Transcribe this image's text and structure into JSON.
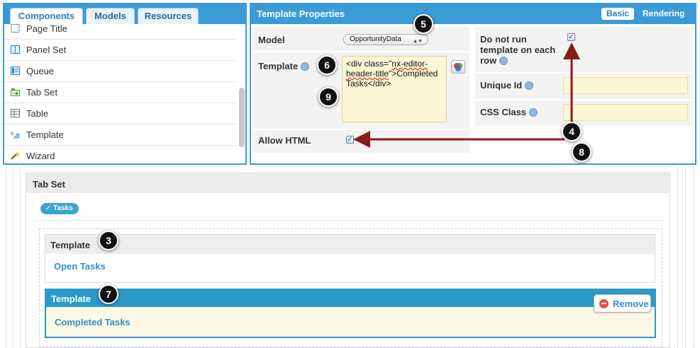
{
  "left_panel": {
    "tabs": [
      {
        "label": "Components",
        "active": true
      },
      {
        "label": "Models",
        "active": false
      },
      {
        "label": "Resources",
        "active": false
      }
    ],
    "items": [
      {
        "label": "Page Title",
        "icon": "page-icon"
      },
      {
        "label": "Panel Set",
        "icon": "panel-set-icon"
      },
      {
        "label": "Queue",
        "icon": "queue-icon"
      },
      {
        "label": "Tab Set",
        "icon": "tab-set-icon"
      },
      {
        "label": "Table",
        "icon": "table-icon"
      },
      {
        "label": "Template",
        "icon": "template-icon"
      },
      {
        "label": "Wizard",
        "icon": "wizard-wand-icon"
      }
    ]
  },
  "properties": {
    "title": "Template Properties",
    "tabs": [
      {
        "label": "Basic",
        "active": true
      },
      {
        "label": "Rendering",
        "active": false
      }
    ],
    "model_label": "Model",
    "model_value": "OpportunityData",
    "template_label": "Template",
    "template_value_parts": [
      "<div class=\"",
      "nx-editor-header-title",
      "\">Completed Tasks</div>"
    ],
    "allow_html_label": "Allow HTML",
    "allow_html_checked": true,
    "do_not_run_label": "Do not run template on each row",
    "do_not_run_checked": true,
    "unique_id_label": "Unique Id",
    "unique_id_value": "",
    "css_class_label": "CSS Class",
    "css_class_value": ""
  },
  "canvas": {
    "tabset_title": "Tab Set",
    "tab_pill": "Tasks",
    "templates": [
      {
        "title": "Template",
        "link": "Open Tasks",
        "selected": false
      },
      {
        "title": "Template",
        "link": "Completed Tasks",
        "selected": true
      }
    ],
    "remove_label": "Remove"
  },
  "callouts": [
    "3",
    "4",
    "5",
    "6",
    "7",
    "8",
    "9"
  ],
  "colors": {
    "accent": "#3a9bd6",
    "link": "#2f8fc6",
    "input_yellow": "#fbf6d4",
    "arrow": "#8b1a1a",
    "remove_icon": "#e2503c"
  }
}
